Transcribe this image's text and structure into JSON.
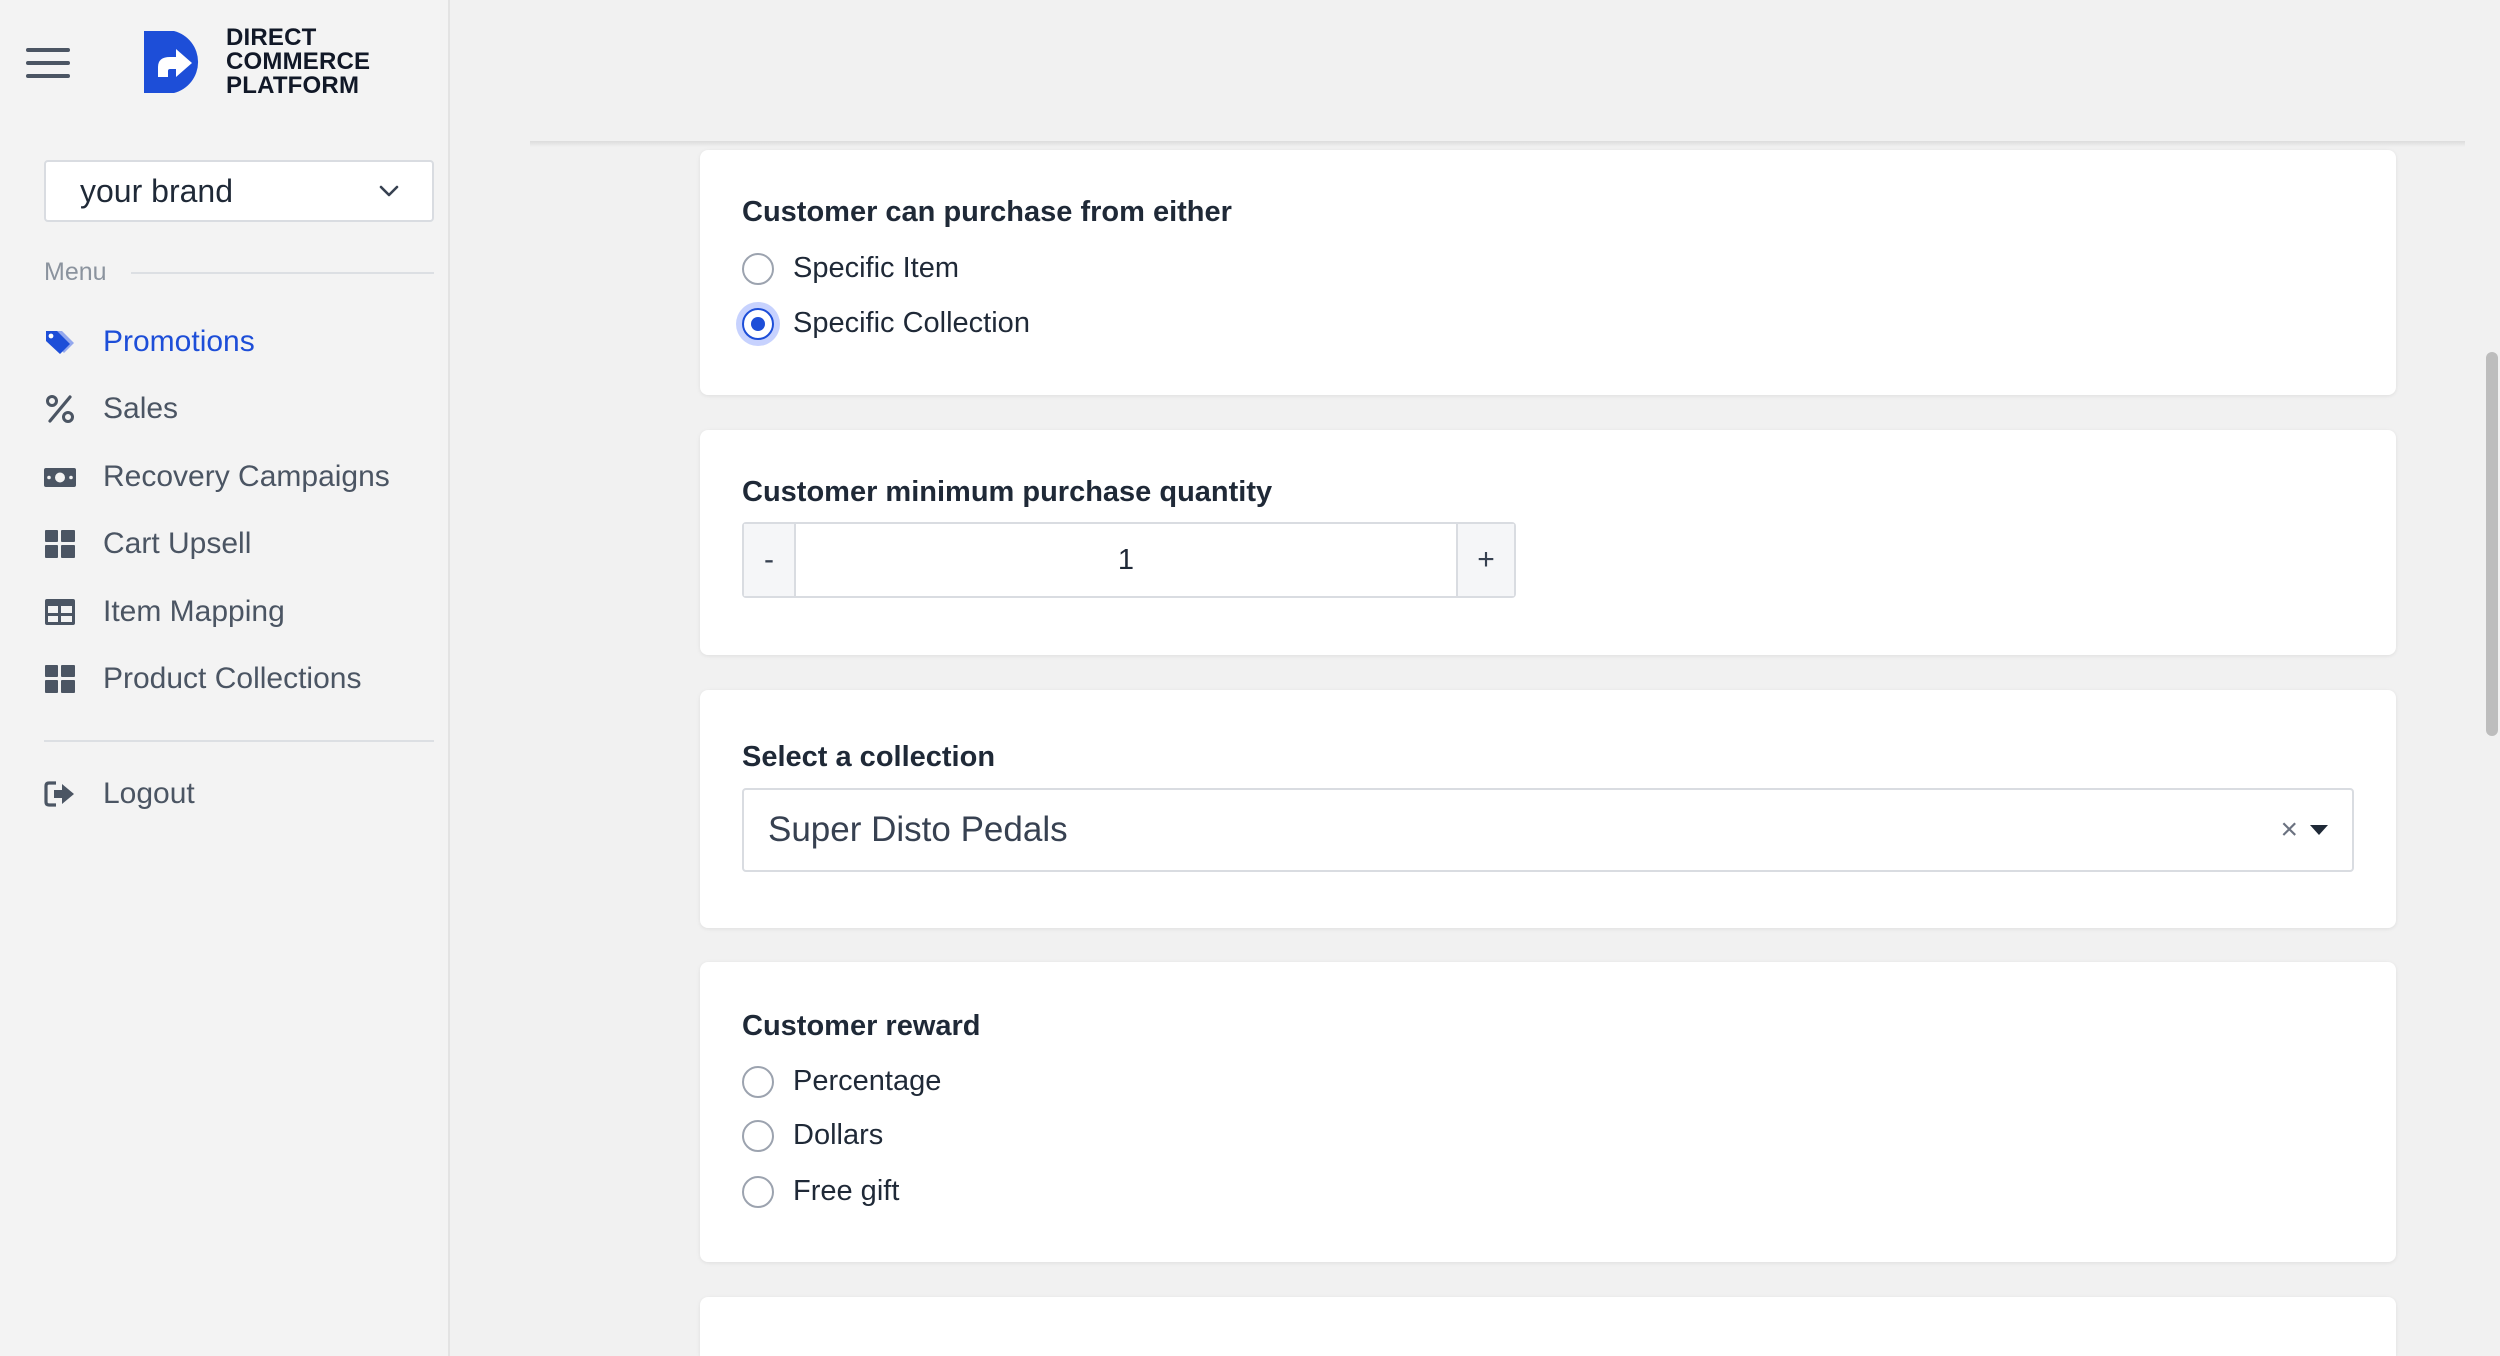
{
  "brand": {
    "name_lines": [
      "DIRECT",
      "COMMERCE",
      "PLATFORM"
    ],
    "accent": "#1d4ed8"
  },
  "sidebar": {
    "brand_select_value": "your brand",
    "menu_label": "Menu",
    "items": [
      {
        "label": "Promotions",
        "icon": "tags-icon",
        "active": true
      },
      {
        "label": "Sales",
        "icon": "percent-icon",
        "active": false
      },
      {
        "label": "Recovery Campaigns",
        "icon": "money-bill-icon",
        "active": false
      },
      {
        "label": "Cart Upsell",
        "icon": "grid-icon",
        "active": false
      },
      {
        "label": "Item Mapping",
        "icon": "table-icon",
        "active": false
      },
      {
        "label": "Product Collections",
        "icon": "grid-icon",
        "active": false
      }
    ],
    "logout_label": "Logout"
  },
  "purchase_from": {
    "title": "Customer can purchase from either",
    "options": [
      "Specific Item",
      "Specific Collection"
    ],
    "selected": "Specific Collection"
  },
  "min_quantity": {
    "title": "Customer minimum purchase quantity",
    "minus": "-",
    "value": "1",
    "plus": "+"
  },
  "collection": {
    "title": "Select a collection",
    "value": "Super Disto Pedals",
    "clear": "×"
  },
  "reward": {
    "title": "Customer reward",
    "options": [
      "Percentage",
      "Dollars",
      "Free gift"
    ],
    "selected": null
  }
}
